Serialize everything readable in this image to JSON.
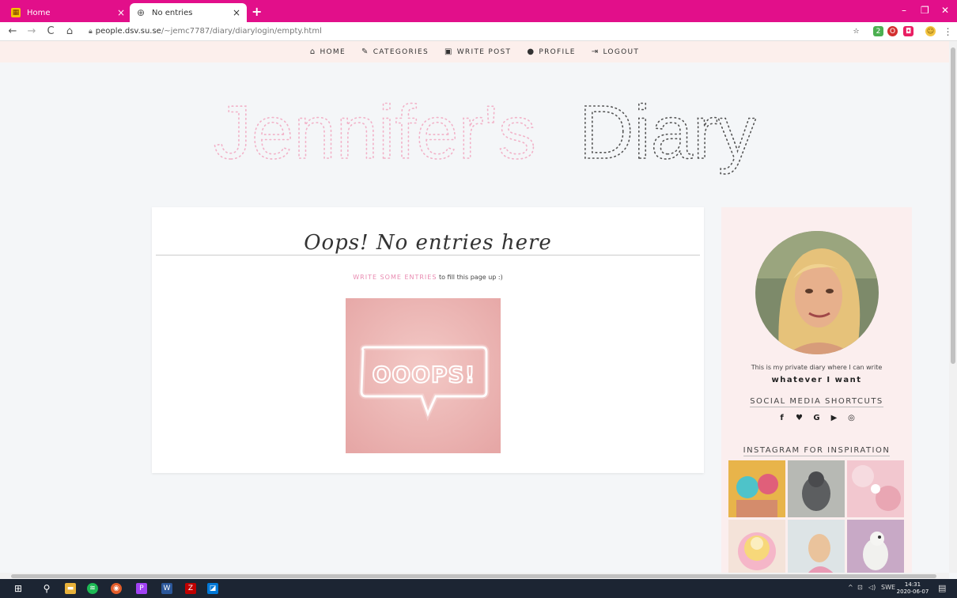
{
  "browser": {
    "tabs": [
      {
        "title": "Home",
        "close": "×"
      },
      {
        "title": "No entries",
        "close": "×"
      }
    ],
    "new_tab": "+",
    "window_controls": {
      "minimize": "–",
      "restore": "❐",
      "close": "✕"
    },
    "nav": {
      "back": "←",
      "forward": "→",
      "reload": "C",
      "home": "⌂"
    },
    "url": {
      "host": "people.dsv.su.se",
      "path": "/~jemc7787/diary/diarylogin/empty.html"
    },
    "extensions": [
      {
        "icon": "star-icon",
        "glyph": "☆",
        "color": "#555"
      },
      {
        "icon": "extension-badge-icon",
        "glyph": "2",
        "color": "#4caf50"
      },
      {
        "icon": "opera-icon",
        "glyph": "O",
        "color": "#d32f2f"
      },
      {
        "icon": "pocket-icon",
        "glyph": "◘",
        "color": "#e91e63"
      },
      {
        "icon": "profile-avatar-icon",
        "glyph": "☺",
        "color": "#f4c542"
      },
      {
        "icon": "menu-dots-icon",
        "glyph": "⋮",
        "color": "#555"
      }
    ]
  },
  "site": {
    "nav": [
      {
        "icon": "home-icon",
        "glyph": "⌂",
        "label": "HOME"
      },
      {
        "icon": "categories-icon",
        "glyph": "✎",
        "label": "CATEGORIES"
      },
      {
        "icon": "write-post-icon",
        "glyph": "▣",
        "label": "WRITE POST"
      },
      {
        "icon": "profile-icon",
        "glyph": "●",
        "label": "PROFILE"
      },
      {
        "icon": "logout-icon",
        "glyph": "⇥",
        "label": "LOGOUT"
      }
    ],
    "hero": {
      "part1": "Jennifer's",
      "part2": "Diary"
    },
    "main": {
      "title": "Oops! No entries here",
      "link_text": "WRITE SOME ENTRIES",
      "after_link": " to fill this page up :)",
      "image_text": "OOOPS!"
    },
    "sidebar": {
      "bio": "This is my private diary where I can write",
      "bio_strong": "whatever I want",
      "social_title": "SOCIAL MEDIA SHORTCUTS",
      "social": [
        {
          "icon": "facebook-icon",
          "glyph": "f"
        },
        {
          "icon": "twitter-icon",
          "glyph": "♥"
        },
        {
          "icon": "google-icon",
          "glyph": "G"
        },
        {
          "icon": "youtube-icon",
          "glyph": "▶"
        },
        {
          "icon": "instagram-icon",
          "glyph": "◎"
        }
      ],
      "insta_title": "INSTAGRAM FOR INSPIRATION"
    }
  },
  "taskbar": {
    "icons": [
      {
        "icon": "windows-start-icon",
        "glyph": "⊞",
        "color": "#1c2533"
      },
      {
        "icon": "search-icon",
        "glyph": "⚲",
        "color": "#1c2533"
      },
      {
        "icon": "file-explorer-icon",
        "glyph": "▬",
        "color": "#e8b13a"
      },
      {
        "icon": "spotify-icon",
        "glyph": "≋",
        "color": "#1db954"
      },
      {
        "icon": "chrome-icon",
        "glyph": "◉",
        "color": "#e35d2a"
      },
      {
        "icon": "phpstorm-icon",
        "glyph": "P",
        "color": "#a142f4"
      },
      {
        "icon": "word-icon",
        "glyph": "W",
        "color": "#2b579a"
      },
      {
        "icon": "filezilla-icon",
        "glyph": "Z",
        "color": "#bf0000"
      },
      {
        "icon": "photos-icon",
        "glyph": "◪",
        "color": "#0078d7"
      }
    ],
    "tray": {
      "chevron": "^",
      "network": "⊡",
      "volume": "◁)",
      "language": "SWE",
      "notifications": "▤"
    },
    "clock": {
      "time": "14:31",
      "date": "2020-06-07"
    }
  }
}
